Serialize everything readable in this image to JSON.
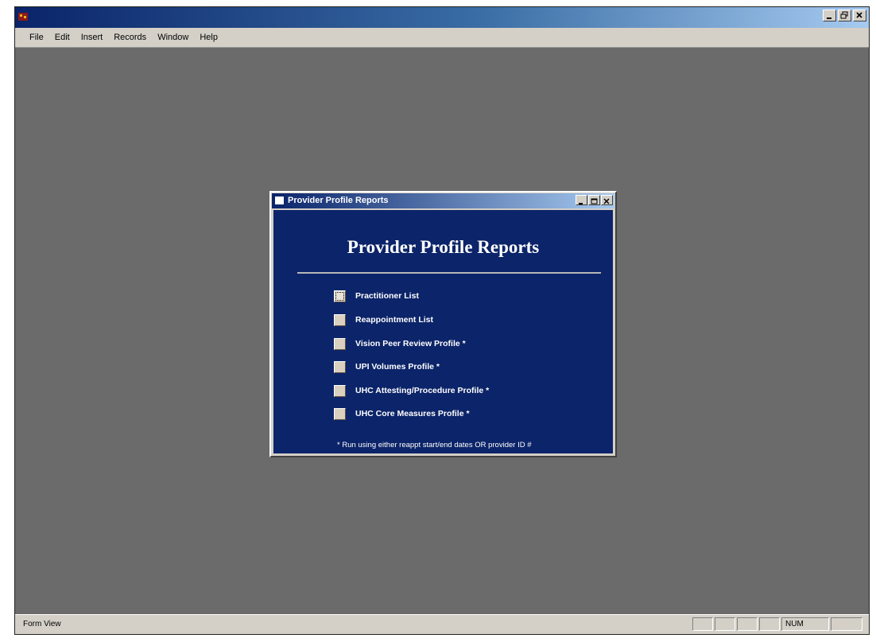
{
  "menubar": {
    "items": [
      "File",
      "Edit",
      "Insert",
      "Records",
      "Window",
      "Help"
    ]
  },
  "dialog": {
    "title": "Provider Profile Reports",
    "heading": "Provider Profile Reports",
    "reports": [
      {
        "label": "Practitioner List",
        "selected": true
      },
      {
        "label": "Reappointment List",
        "selected": false
      },
      {
        "label": "Vision Peer Review Profile *",
        "selected": false
      },
      {
        "label": "UPI Volumes Profile *",
        "selected": false
      },
      {
        "label": "UHC Attesting/Procedure Profile *",
        "selected": false
      },
      {
        "label": "UHC Core Measures Profile *",
        "selected": false
      }
    ],
    "footnote": "* Run using either reappt start/end dates OR provider ID #"
  },
  "statusbar": {
    "mode": "Form View",
    "num": "NUM"
  },
  "colors": {
    "panel": "#0c2469",
    "workspace": "#6b6b6b",
    "chrome": "#d4d0c8"
  }
}
